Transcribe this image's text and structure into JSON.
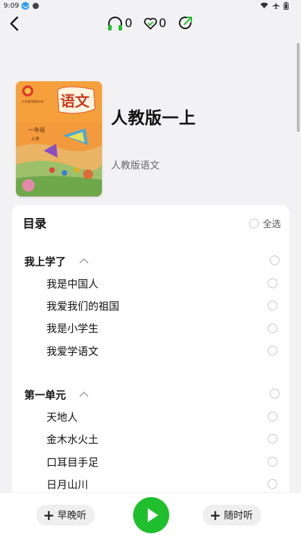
{
  "status_bar": {
    "time": "9:09"
  },
  "topnav": {
    "listen_count": "0",
    "like_count": "0"
  },
  "book": {
    "title": "人教版一上",
    "subtitle": "人教版语文",
    "cover_text": {
      "series": "义务教育教科书",
      "subject": "语文",
      "grade": "一年级",
      "volume": "上册"
    }
  },
  "toc": {
    "title": "目录",
    "select_all_label": "全选",
    "sections": [
      {
        "title": "我上学了",
        "lessons": [
          "我是中国人",
          "我爱我们的祖国",
          "我是小学生",
          "我爱学语文"
        ]
      },
      {
        "title": "第一单元",
        "lessons": [
          "天地人",
          "金木水火土",
          "口耳目手足",
          "日月山川"
        ]
      }
    ]
  },
  "bottom_bar": {
    "morning_evening_label": "早晚听",
    "random_label": "随时听"
  },
  "colors": {
    "accent_green": "#1fbf2e",
    "card_bg": "#ffffff",
    "page_bg": "#f2f2f4"
  }
}
